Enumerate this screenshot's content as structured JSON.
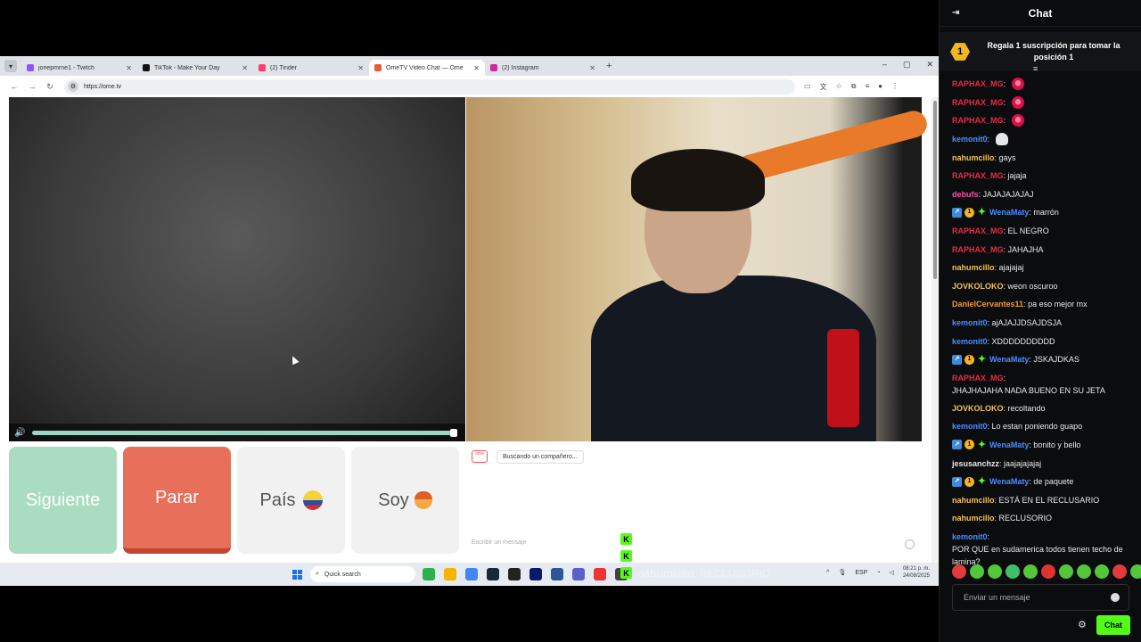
{
  "browser": {
    "tabs": [
      {
        "title": "joriepmrne1 - Twitch",
        "color": "#8f55ff"
      },
      {
        "title": "TikTok - Make Your Day",
        "color": "#111111"
      },
      {
        "title": "(2) Tinder",
        "color": "#fe3c72"
      },
      {
        "title": "OmeTV Video Chat — Ome",
        "color": "#e85a3a"
      },
      {
        "title": "(2) Instagram",
        "color": "#d6249f"
      }
    ],
    "url": "https://ome.tv"
  },
  "ometv": {
    "buttons": {
      "next": "Siguiente",
      "stop": "Parar",
      "country": "País",
      "soy": "Soy"
    },
    "searching": "Buscando un compañero...",
    "message_placeholder": "Escribir un mensaje"
  },
  "taskbar": {
    "search_placeholder": "Quick search",
    "lang": "ESP",
    "time": "08:21 p. m.",
    "date": "24/08/2025"
  },
  "overlay": [
    {
      "badge": "K",
      "name": "WenaMaty",
      "message": "de paquete"
    },
    {
      "badge": "K",
      "name": "nahumcillo",
      "message": "ESTÁ EN EL RECLUSARIO"
    },
    {
      "badge": "K",
      "name": "nahumcillo",
      "message": "RECLUSORIO"
    }
  ],
  "sidebar": {
    "title": "Chat",
    "gift_rank": "1",
    "gift_text": "Regala 1 suscripción para tomar la posición 1",
    "input_placeholder": "Enviar un mensaje",
    "send_label": "Chat",
    "messages": [
      {
        "user": "RAPHAX_MG",
        "color": "#e8294a",
        "text": "",
        "emote": "red"
      },
      {
        "user": "RAPHAX_MG",
        "color": "#e8294a",
        "text": "",
        "emote": "red"
      },
      {
        "user": "RAPHAX_MG",
        "color": "#e8294a",
        "text": "",
        "emote": "red"
      },
      {
        "user": "kemonit0",
        "color": "#4c8dff",
        "text": "",
        "emote": "ghost"
      },
      {
        "user": "nahumcillo",
        "color": "#f2c15a",
        "text": "gays"
      },
      {
        "user": "RAPHAX_MG",
        "color": "#e8294a",
        "text": "jajaja"
      },
      {
        "user": "debufs",
        "color": "#ff4fb0",
        "text": "JAJAJAJAJAJ"
      },
      {
        "user": "WenaMaty",
        "color": "#4c8dff",
        "text": "marrón",
        "badges": true
      },
      {
        "user": "RAPHAX_MG",
        "color": "#e8294a",
        "text": "EL NEGRO"
      },
      {
        "user": "RAPHAX_MG",
        "color": "#e8294a",
        "text": "JAHAJHA"
      },
      {
        "user": "nahumcillo",
        "color": "#f2c15a",
        "text": "ajajajaj"
      },
      {
        "user": "JOVKOLOKO",
        "color": "#f2c15a",
        "text": "weon oscuroo"
      },
      {
        "user": "DanielCervantes11",
        "color": "#f29a2e",
        "text": "pa eso mejor mx"
      },
      {
        "user": "kemonit0",
        "color": "#4c8dff",
        "text": "ajAJAJJDSAJDSJA"
      },
      {
        "user": "kemonit0",
        "color": "#4c8dff",
        "text": "XDDDDDDDDDD"
      },
      {
        "user": "WenaMaty",
        "color": "#4c8dff",
        "text": "JSKAJDKAS",
        "badges": true
      },
      {
        "user": "RAPHAX_MG",
        "color": "#e8294a",
        "text": "JHAJHAJAHA NADA BUENO EN SU JETA"
      },
      {
        "user": "JOVKOLOKO",
        "color": "#f2c15a",
        "text": "recoltando"
      },
      {
        "user": "kemonit0",
        "color": "#4c8dff",
        "text": "Lo estan poniendo guapo"
      },
      {
        "user": "WenaMaty",
        "color": "#4c8dff",
        "text": "bonito y bello",
        "badges": true
      },
      {
        "user": "jesusanchzz",
        "color": "#e9e9e9",
        "text": "jaajajajajaj"
      },
      {
        "user": "WenaMaty",
        "color": "#4c8dff",
        "text": "de paquete",
        "badges": true
      },
      {
        "user": "nahumcillo",
        "color": "#f2c15a",
        "text": "ESTÁ EN EL RECLUSARIO"
      },
      {
        "user": "nahumcillo",
        "color": "#f2c15a",
        "text": "RECLUSORIO"
      },
      {
        "user": "kemonit0",
        "color": "#4c8dff",
        "text": "POR QUE en sudamerica todos tienen techo de lamina?"
      }
    ],
    "emoji_colors": [
      "#e23b3b",
      "#53c63a",
      "#53c63a",
      "#3fbf6a",
      "#53c63a",
      "#d33",
      "#53c63a",
      "#53c63a",
      "#53c63a",
      "#e23b3b",
      "#53c63a"
    ]
  }
}
